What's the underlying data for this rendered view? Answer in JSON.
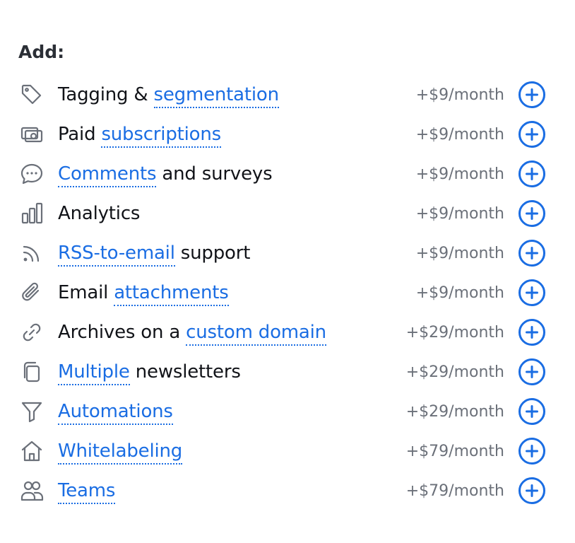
{
  "heading": "Add:",
  "addons": [
    {
      "icon": "tag-icon",
      "prefix": "Tagging & ",
      "link": "segmentation",
      "suffix": "",
      "price": "+$9/month"
    },
    {
      "icon": "money-icon",
      "prefix": "Paid ",
      "link": "subscriptions",
      "suffix": "",
      "price": "+$9/month"
    },
    {
      "icon": "chat-bubble-icon",
      "prefix": "",
      "link": "Comments",
      "suffix": " and surveys",
      "price": "+$9/month"
    },
    {
      "icon": "bar-chart-icon",
      "prefix": "Analytics",
      "link": "",
      "suffix": "",
      "price": "+$9/month"
    },
    {
      "icon": "rss-icon",
      "prefix": "",
      "link": "RSS-to-email",
      "suffix": " support",
      "price": "+$9/month"
    },
    {
      "icon": "paperclip-icon",
      "prefix": "Email ",
      "link": "attachments",
      "suffix": "",
      "price": "+$9/month"
    },
    {
      "icon": "link-icon",
      "prefix": "Archives on a ",
      "link": "custom domain",
      "suffix": "",
      "price": "+$29/month"
    },
    {
      "icon": "copy-icon",
      "prefix": "",
      "link": "Multiple",
      "suffix": " newsletters",
      "price": "+$29/month"
    },
    {
      "icon": "filter-icon",
      "prefix": "",
      "link": "Automations",
      "suffix": "",
      "price": "+$29/month"
    },
    {
      "icon": "home-icon",
      "prefix": "",
      "link": "Whitelabeling",
      "suffix": "",
      "price": "+$79/month"
    },
    {
      "icon": "users-icon",
      "prefix": "",
      "link": "Teams",
      "suffix": "",
      "price": "+$79/month"
    }
  ],
  "colors": {
    "accent": "#1a6de3",
    "muted": "#6b7079",
    "text": "#111318"
  }
}
